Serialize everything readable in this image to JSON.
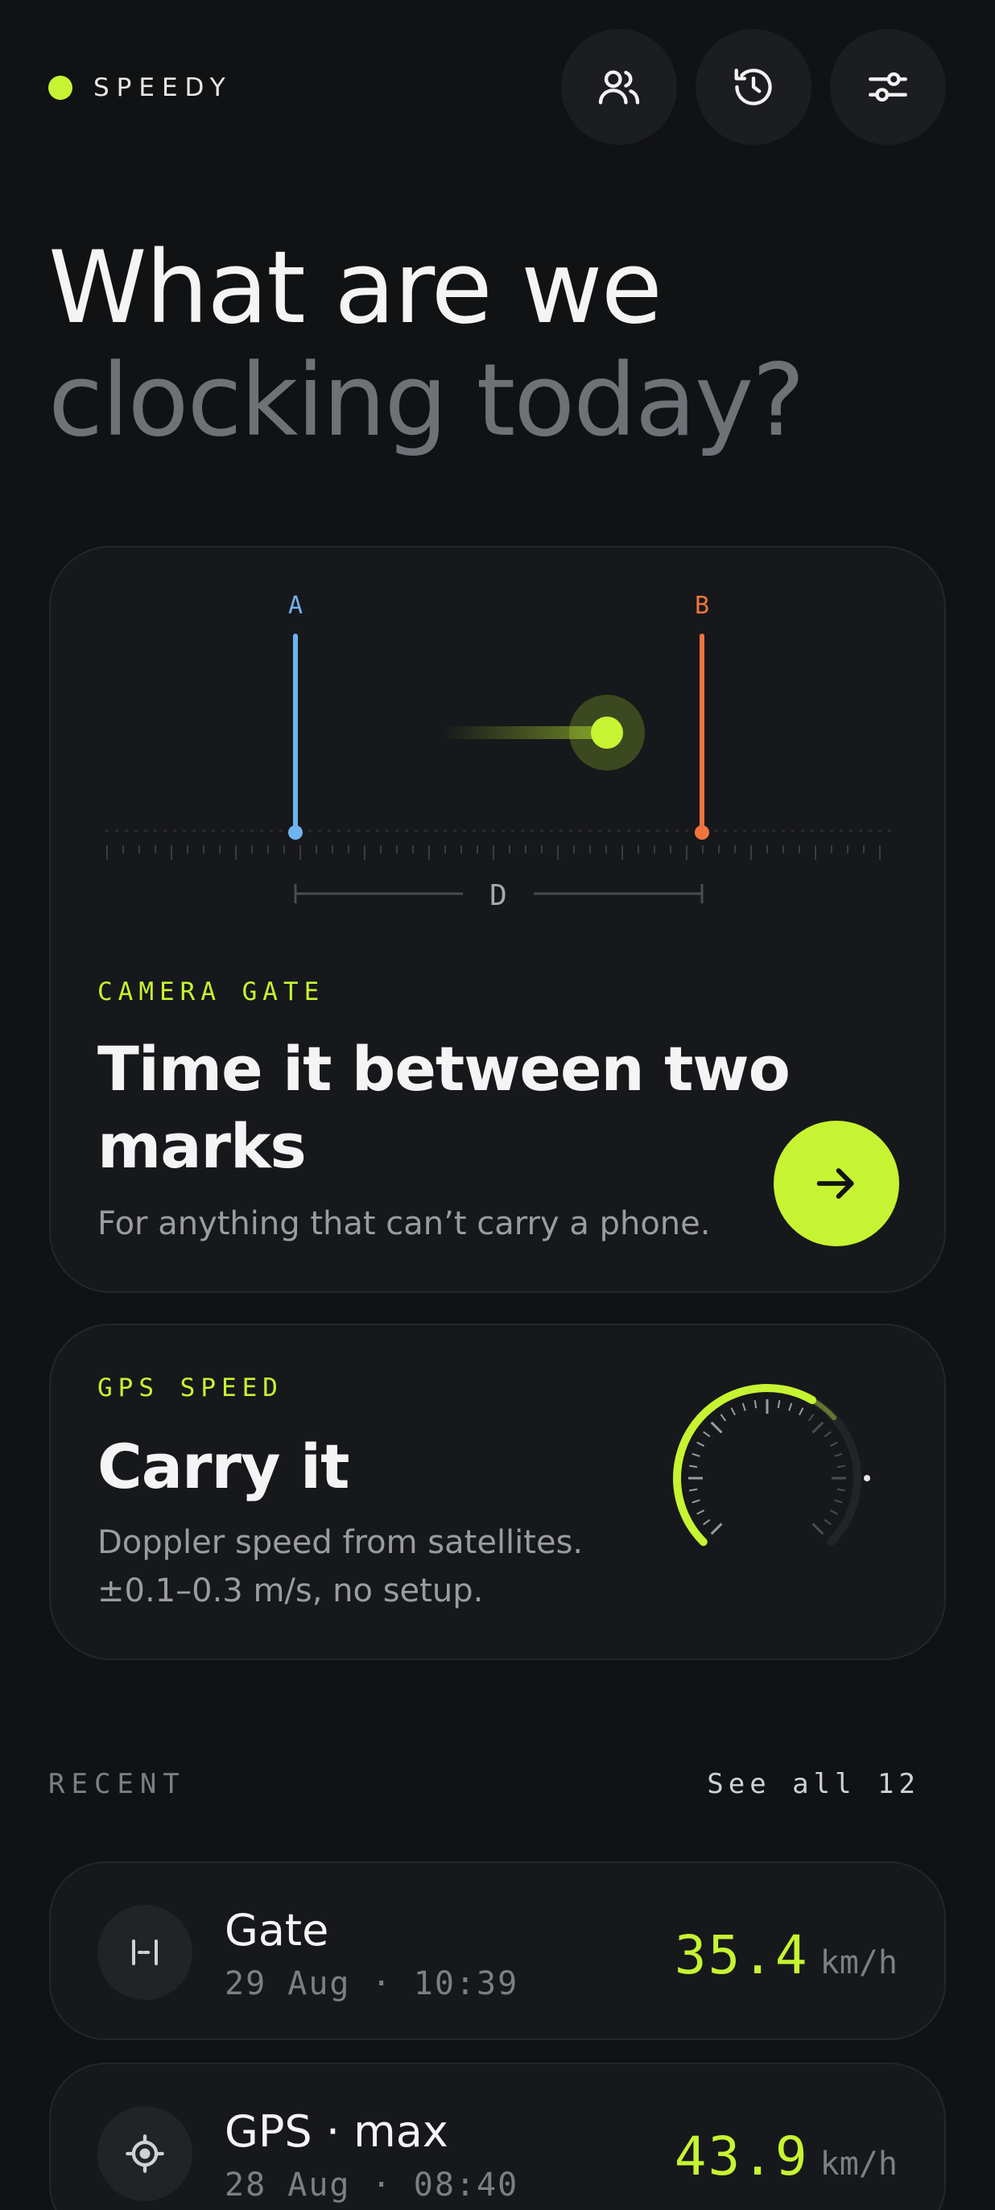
{
  "brand": {
    "name": "SPEEDY",
    "accent": "#c6f432"
  },
  "header": {
    "buttons": [
      {
        "icon": "users-icon"
      },
      {
        "icon": "history-icon"
      },
      {
        "icon": "sliders-icon"
      }
    ]
  },
  "headline": {
    "line1": "What are we",
    "line2": "clocking today?"
  },
  "gate_card": {
    "illustration": {
      "mark_a": "A",
      "mark_b": "B",
      "distance_label": "D",
      "color_a": "#6fb3ef",
      "color_b": "#f0743d"
    },
    "eyebrow": "CAMERA GATE",
    "title_line1": "Time it between two",
    "title_line2": "marks",
    "description": "For anything that can’t carry a phone.",
    "action_icon": "arrow-right-icon"
  },
  "gps_card": {
    "eyebrow": "GPS SPEED",
    "title": "Carry it",
    "description_line1": "Doppler speed from satellites.",
    "description_line2": "±0.1–0.3 m/s, no setup."
  },
  "recent": {
    "label": "RECENT",
    "see_all": "See all 12",
    "items": [
      {
        "icon": "gate-icon",
        "title": "Gate",
        "subtitle": "29 Aug · 10:39",
        "value": "35.4",
        "unit": "km/h"
      },
      {
        "icon": "crosshair-icon",
        "title": "GPS · max",
        "subtitle": "28 Aug · 08:40",
        "value": "43.9",
        "unit": "km/h"
      }
    ]
  }
}
